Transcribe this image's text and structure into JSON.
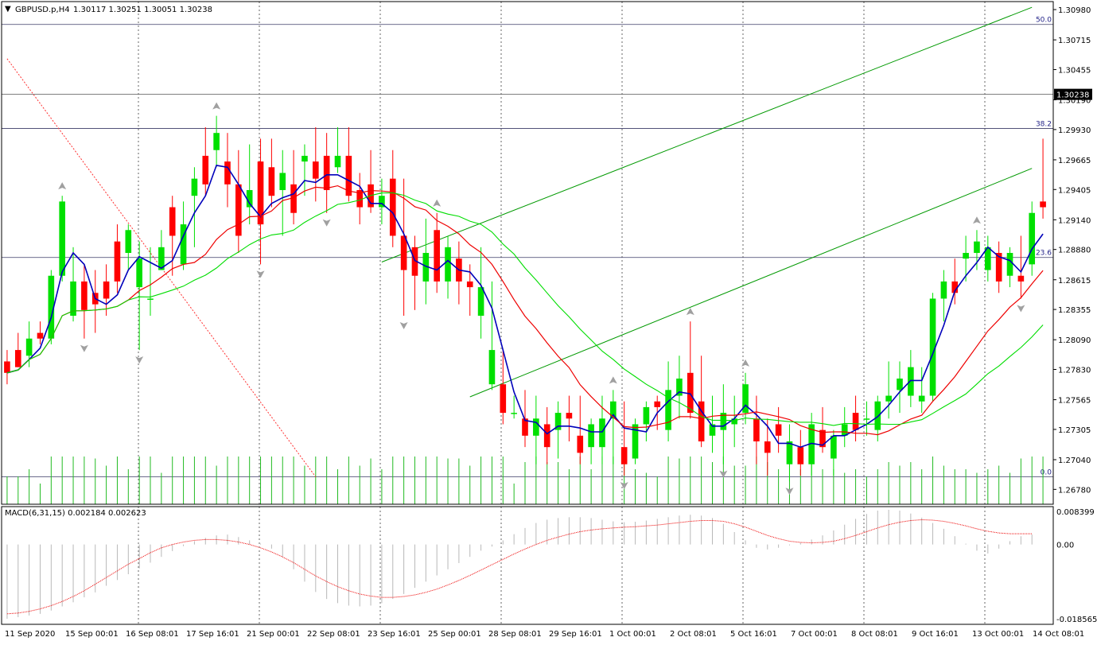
{
  "header": {
    "symbol": "GBPUSD.p,H4",
    "ohlc": "1.30117 1.30251 1.30051 1.30238",
    "macd_label": "MACD(6,31,15) 0.002184 0.002623"
  },
  "colors": {
    "bull": "#00e000",
    "bear": "#ff0000",
    "ma_fast": "#0000bb",
    "ma_mid": "#ee0000",
    "ma_slow": "#00dd00",
    "channel": "#009900",
    "volume": "#22bb22",
    "macd_hist": "#b8b8b8",
    "macd_signal": "#ee0000",
    "grid": "#000000",
    "fractal": "#a0a0a0"
  },
  "chart_data": [
    {
      "type": "candlestick",
      "title": "GBPUSD.p,H4",
      "ylim": [
        1.2665,
        1.3105
      ],
      "price_ticks": [
        "1.30980",
        "1.30715",
        "1.30455",
        "1.30190",
        "1.29930",
        "1.29665",
        "1.29405",
        "1.29140",
        "1.28880",
        "1.28615",
        "1.28355",
        "1.28090",
        "1.27830",
        "1.27565",
        "1.27305",
        "1.27040",
        "1.26780"
      ],
      "current_price": "1.30238",
      "time_labels": [
        "11 Sep 2020",
        "15 Sep 00:01",
        "16 Sep 08:01",
        "17 Sep 16:01",
        "21 Sep 00:01",
        "22 Sep 08:01",
        "23 Sep 16:01",
        "25 Sep 00:01",
        "28 Sep 08:01",
        "29 Sep 16:01",
        "1 Oct 00:01",
        "2 Oct 08:01",
        "5 Oct 16:01",
        "7 Oct 00:01",
        "8 Oct 08:01",
        "9 Oct 16:01",
        "13 Oct 00:01",
        "14 Oct 08:01"
      ],
      "fib_levels": [
        {
          "label": "50.0",
          "value": 1.3085
        },
        {
          "label": "38.2",
          "value": 1.2994
        },
        {
          "label": "23.6",
          "value": 1.2881
        },
        {
          "label": "0.0",
          "value": 1.2689
        }
      ],
      "horizontal_line": 1.30238,
      "channel": {
        "upper": {
          "from": [
            34,
            1.2877
          ],
          "to": [
            93,
            1.31
          ]
        },
        "lower": {
          "from": [
            42,
            1.2759
          ],
          "to": [
            93,
            1.2959
          ]
        }
      },
      "trend_line": {
        "from": [
          0,
          1.3055
        ],
        "to": [
          28,
          1.2689
        ]
      },
      "candles": [
        {
          "o": 1.279,
          "h": 1.28,
          "l": 1.277,
          "c": 1.278
        },
        {
          "o": 1.28,
          "h": 1.2815,
          "l": 1.2785,
          "c": 1.2785
        },
        {
          "o": 1.2795,
          "h": 1.2825,
          "l": 1.2785,
          "c": 1.281
        },
        {
          "o": 1.2815,
          "h": 1.2825,
          "l": 1.2805,
          "c": 1.281
        },
        {
          "o": 1.281,
          "h": 1.287,
          "l": 1.2805,
          "c": 1.2865
        },
        {
          "o": 1.2865,
          "h": 1.2935,
          "l": 1.286,
          "c": 1.293
        },
        {
          "o": 1.283,
          "h": 1.289,
          "l": 1.2825,
          "c": 1.286
        },
        {
          "o": 1.286,
          "h": 1.2875,
          "l": 1.281,
          "c": 1.2835
        },
        {
          "o": 1.285,
          "h": 1.287,
          "l": 1.2815,
          "c": 1.284
        },
        {
          "o": 1.286,
          "h": 1.2875,
          "l": 1.283,
          "c": 1.2845
        },
        {
          "o": 1.2895,
          "h": 1.291,
          "l": 1.285,
          "c": 1.286
        },
        {
          "o": 1.2885,
          "h": 1.291,
          "l": 1.287,
          "c": 1.2905
        },
        {
          "o": 1.2855,
          "h": 1.2895,
          "l": 1.28,
          "c": 1.288
        },
        {
          "o": 1.2845,
          "h": 1.289,
          "l": 1.283,
          "c": 1.2845
        },
        {
          "o": 1.287,
          "h": 1.2905,
          "l": 1.287,
          "c": 1.289
        },
        {
          "o": 1.2925,
          "h": 1.2935,
          "l": 1.2865,
          "c": 1.29
        },
        {
          "o": 1.2875,
          "h": 1.293,
          "l": 1.287,
          "c": 1.291
        },
        {
          "o": 1.2935,
          "h": 1.296,
          "l": 1.289,
          "c": 1.295
        },
        {
          "o": 1.297,
          "h": 1.2995,
          "l": 1.2935,
          "c": 1.2945
        },
        {
          "o": 1.2975,
          "h": 1.3005,
          "l": 1.296,
          "c": 1.299
        },
        {
          "o": 1.2965,
          "h": 1.299,
          "l": 1.2925,
          "c": 1.2945
        },
        {
          "o": 1.2945,
          "h": 1.2975,
          "l": 1.2885,
          "c": 1.29
        },
        {
          "o": 1.2925,
          "h": 1.298,
          "l": 1.291,
          "c": 1.294
        },
        {
          "o": 1.2965,
          "h": 1.2985,
          "l": 1.2875,
          "c": 1.291
        },
        {
          "o": 1.296,
          "h": 1.2985,
          "l": 1.2925,
          "c": 1.2935
        },
        {
          "o": 1.294,
          "h": 1.2975,
          "l": 1.29,
          "c": 1.2955
        },
        {
          "o": 1.2945,
          "h": 1.2975,
          "l": 1.291,
          "c": 1.292
        },
        {
          "o": 1.2965,
          "h": 1.298,
          "l": 1.2935,
          "c": 1.297
        },
        {
          "o": 1.2965,
          "h": 1.2995,
          "l": 1.293,
          "c": 1.295
        },
        {
          "o": 1.297,
          "h": 1.299,
          "l": 1.292,
          "c": 1.294
        },
        {
          "o": 1.296,
          "h": 1.2995,
          "l": 1.2955,
          "c": 1.297
        },
        {
          "o": 1.297,
          "h": 1.2995,
          "l": 1.293,
          "c": 1.2935
        },
        {
          "o": 1.294,
          "h": 1.2955,
          "l": 1.291,
          "c": 1.2925
        },
        {
          "o": 1.2945,
          "h": 1.2975,
          "l": 1.292,
          "c": 1.2925
        },
        {
          "o": 1.2925,
          "h": 1.295,
          "l": 1.291,
          "c": 1.2935
        },
        {
          "o": 1.295,
          "h": 1.2975,
          "l": 1.289,
          "c": 1.29
        },
        {
          "o": 1.29,
          "h": 1.295,
          "l": 1.283,
          "c": 1.287
        },
        {
          "o": 1.289,
          "h": 1.29,
          "l": 1.2835,
          "c": 1.2865
        },
        {
          "o": 1.286,
          "h": 1.2915,
          "l": 1.284,
          "c": 1.2885
        },
        {
          "o": 1.2905,
          "h": 1.292,
          "l": 1.285,
          "c": 1.286
        },
        {
          "o": 1.286,
          "h": 1.29,
          "l": 1.2845,
          "c": 1.289
        },
        {
          "o": 1.288,
          "h": 1.2895,
          "l": 1.284,
          "c": 1.286
        },
        {
          "o": 1.286,
          "h": 1.2875,
          "l": 1.283,
          "c": 1.2855
        },
        {
          "o": 1.283,
          "h": 1.289,
          "l": 1.281,
          "c": 1.2855
        },
        {
          "o": 1.277,
          "h": 1.286,
          "l": 1.2765,
          "c": 1.28
        },
        {
          "o": 1.277,
          "h": 1.28,
          "l": 1.2735,
          "c": 1.2745
        },
        {
          "o": 1.2745,
          "h": 1.276,
          "l": 1.274,
          "c": 1.2745
        },
        {
          "o": 1.274,
          "h": 1.2765,
          "l": 1.2715,
          "c": 1.2725
        },
        {
          "o": 1.2725,
          "h": 1.276,
          "l": 1.27,
          "c": 1.274
        },
        {
          "o": 1.2735,
          "h": 1.275,
          "l": 1.27,
          "c": 1.2715
        },
        {
          "o": 1.273,
          "h": 1.2755,
          "l": 1.2705,
          "c": 1.2745
        },
        {
          "o": 1.2745,
          "h": 1.276,
          "l": 1.272,
          "c": 1.274
        },
        {
          "o": 1.2725,
          "h": 1.276,
          "l": 1.27,
          "c": 1.271
        },
        {
          "o": 1.2715,
          "h": 1.274,
          "l": 1.27,
          "c": 1.2735
        },
        {
          "o": 1.2715,
          "h": 1.276,
          "l": 1.27,
          "c": 1.274
        },
        {
          "o": 1.274,
          "h": 1.2765,
          "l": 1.27,
          "c": 1.2755
        },
        {
          "o": 1.2715,
          "h": 1.2755,
          "l": 1.269,
          "c": 1.27
        },
        {
          "o": 1.2705,
          "h": 1.274,
          "l": 1.27,
          "c": 1.2735
        },
        {
          "o": 1.2735,
          "h": 1.2755,
          "l": 1.272,
          "c": 1.275
        },
        {
          "o": 1.2755,
          "h": 1.276,
          "l": 1.273,
          "c": 1.275
        },
        {
          "o": 1.273,
          "h": 1.279,
          "l": 1.272,
          "c": 1.2765
        },
        {
          "o": 1.276,
          "h": 1.2795,
          "l": 1.274,
          "c": 1.2775
        },
        {
          "o": 1.278,
          "h": 1.2825,
          "l": 1.274,
          "c": 1.2745
        },
        {
          "o": 1.2755,
          "h": 1.2795,
          "l": 1.2715,
          "c": 1.272
        },
        {
          "o": 1.2725,
          "h": 1.276,
          "l": 1.271,
          "c": 1.2735
        },
        {
          "o": 1.273,
          "h": 1.277,
          "l": 1.27,
          "c": 1.2745
        },
        {
          "o": 1.2735,
          "h": 1.276,
          "l": 1.2715,
          "c": 1.274
        },
        {
          "o": 1.2745,
          "h": 1.278,
          "l": 1.2735,
          "c": 1.277
        },
        {
          "o": 1.274,
          "h": 1.276,
          "l": 1.27,
          "c": 1.272
        },
        {
          "o": 1.272,
          "h": 1.274,
          "l": 1.269,
          "c": 1.271
        },
        {
          "o": 1.2735,
          "h": 1.275,
          "l": 1.271,
          "c": 1.2725
        },
        {
          "o": 1.27,
          "h": 1.2735,
          "l": 1.2685,
          "c": 1.272
        },
        {
          "o": 1.2715,
          "h": 1.273,
          "l": 1.269,
          "c": 1.27
        },
        {
          "o": 1.27,
          "h": 1.2745,
          "l": 1.269,
          "c": 1.2735
        },
        {
          "o": 1.273,
          "h": 1.275,
          "l": 1.271,
          "c": 1.2715
        },
        {
          "o": 1.2705,
          "h": 1.273,
          "l": 1.269,
          "c": 1.2725
        },
        {
          "o": 1.2725,
          "h": 1.275,
          "l": 1.2715,
          "c": 1.2735
        },
        {
          "o": 1.2745,
          "h": 1.276,
          "l": 1.272,
          "c": 1.273
        },
        {
          "o": 1.274,
          "h": 1.2755,
          "l": 1.2725,
          "c": 1.274
        },
        {
          "o": 1.273,
          "h": 1.276,
          "l": 1.272,
          "c": 1.2755
        },
        {
          "o": 1.2755,
          "h": 1.279,
          "l": 1.274,
          "c": 1.276
        },
        {
          "o": 1.2765,
          "h": 1.279,
          "l": 1.2745,
          "c": 1.2775
        },
        {
          "o": 1.276,
          "h": 1.28,
          "l": 1.275,
          "c": 1.2785
        },
        {
          "o": 1.2755,
          "h": 1.2785,
          "l": 1.2745,
          "c": 1.276
        },
        {
          "o": 1.276,
          "h": 1.285,
          "l": 1.2755,
          "c": 1.2845
        },
        {
          "o": 1.2845,
          "h": 1.287,
          "l": 1.2825,
          "c": 1.286
        },
        {
          "o": 1.286,
          "h": 1.288,
          "l": 1.284,
          "c": 1.285
        },
        {
          "o": 1.288,
          "h": 1.29,
          "l": 1.286,
          "c": 1.2885
        },
        {
          "o": 1.2885,
          "h": 1.2905,
          "l": 1.287,
          "c": 1.2895
        },
        {
          "o": 1.287,
          "h": 1.29,
          "l": 1.286,
          "c": 1.289
        },
        {
          "o": 1.2885,
          "h": 1.2895,
          "l": 1.285,
          "c": 1.286
        },
        {
          "o": 1.2865,
          "h": 1.289,
          "l": 1.2855,
          "c": 1.2885
        },
        {
          "o": 1.2865,
          "h": 1.29,
          "l": 1.2845,
          "c": 1.286
        },
        {
          "o": 1.2875,
          "h": 1.293,
          "l": 1.2865,
          "c": 1.292
        },
        {
          "o": 1.293,
          "h": 1.2985,
          "l": 1.2915,
          "c": 1.2925
        }
      ],
      "macd": {
        "histogram": [
          -0.018,
          -0.0176,
          -0.0172,
          -0.0168,
          -0.016,
          -0.015,
          -0.014,
          -0.0128,
          -0.0116,
          -0.01,
          -0.0086,
          -0.0072,
          -0.0058,
          -0.0044,
          -0.003,
          -0.0016,
          -0.0004,
          0.0008,
          0.0016,
          0.0022,
          0.0024,
          0.0018,
          0.001,
          0.0002,
          -0.001,
          -0.003,
          -0.006,
          -0.009,
          -0.0115,
          -0.0132,
          -0.0142,
          -0.0148,
          -0.015,
          -0.0148,
          -0.0142,
          -0.0132,
          -0.012,
          -0.0105,
          -0.009,
          -0.0075,
          -0.006,
          -0.0045,
          -0.003,
          -0.0015,
          -0.0005,
          0.001,
          0.0025,
          0.004,
          0.0052,
          0.006,
          0.0064,
          0.0066,
          0.0066,
          0.0064,
          0.006,
          0.0056,
          0.0054,
          0.0055,
          0.0058,
          0.0062,
          0.0066,
          0.007,
          0.0072,
          0.007,
          0.0064,
          0.005,
          0.003,
          0.001,
          -0.0008,
          -0.0012,
          -0.0008,
          -0.0002,
          0.0004,
          0.0012,
          0.0022,
          0.0034,
          0.0048,
          0.0062,
          0.0074,
          0.0082,
          0.0084,
          0.0082,
          0.0075,
          0.0065,
          0.0052,
          0.0038,
          0.002,
          0.0002,
          -0.0015,
          -0.0022,
          -0.001,
          0.0008,
          0.002,
          0.0024
        ],
        "signal": [
          -0.0168,
          -0.0166,
          -0.0162,
          -0.0156,
          -0.0148,
          -0.0138,
          -0.0126,
          -0.0112,
          -0.0096,
          -0.008,
          -0.0064,
          -0.0048,
          -0.0034,
          -0.002,
          -0.0008,
          0.0,
          0.0006,
          0.001,
          0.0012,
          0.0012,
          0.001,
          0.0006,
          0.0,
          -0.0008,
          -0.0018,
          -0.003,
          -0.0044,
          -0.006,
          -0.0076,
          -0.009,
          -0.0102,
          -0.0112,
          -0.012,
          -0.0125,
          -0.0128,
          -0.0128,
          -0.0126,
          -0.0122,
          -0.0116,
          -0.0108,
          -0.0098,
          -0.0087,
          -0.0075,
          -0.0062,
          -0.0049,
          -0.0036,
          -0.0023,
          -0.0011,
          0.0,
          0.001,
          0.0018,
          0.0025,
          0.0031,
          0.0035,
          0.0038,
          0.004,
          0.0042,
          0.0043,
          0.0045,
          0.0047,
          0.005,
          0.0053,
          0.0056,
          0.0058,
          0.0058,
          0.0056,
          0.005,
          0.0042,
          0.0032,
          0.0022,
          0.0014,
          0.0008,
          0.0005,
          0.0004,
          0.0005,
          0.0008,
          0.0014,
          0.0022,
          0.0031,
          0.004,
          0.0048,
          0.0054,
          0.0058,
          0.006,
          0.0059,
          0.0056,
          0.0051,
          0.0045,
          0.0038,
          0.0032,
          0.0028,
          0.0026,
          0.0026,
          0.0026
        ],
        "ticks": [
          "0.008399",
          "0.00",
          "-0.018565"
        ]
      }
    }
  ]
}
